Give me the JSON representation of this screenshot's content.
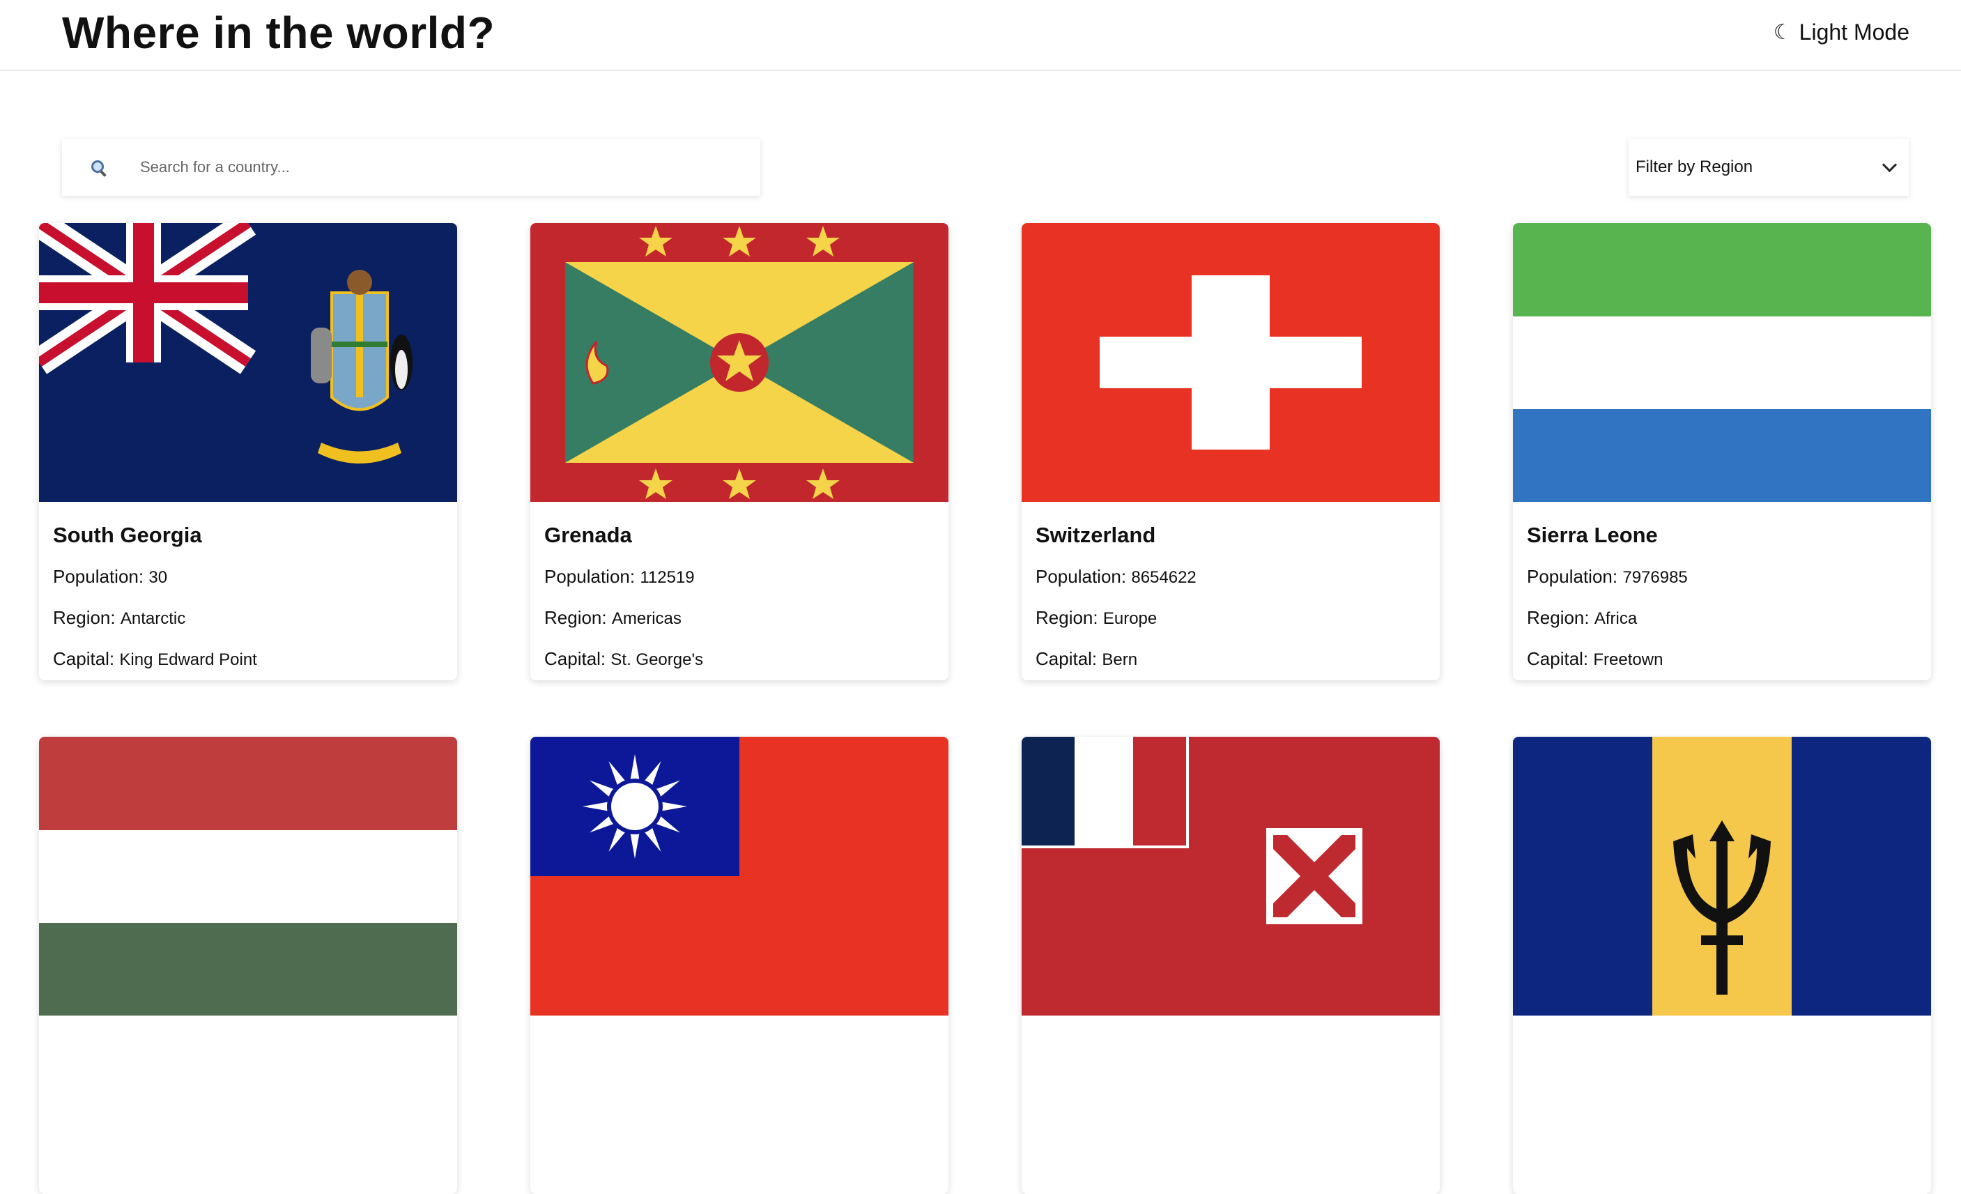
{
  "header": {
    "title": "Where in the world?",
    "theme_icon": "☾",
    "theme_label": "Light Mode"
  },
  "search": {
    "placeholder": "Search for a country...",
    "value": ""
  },
  "filter": {
    "label": "Filter by Region"
  },
  "field_labels": {
    "population": "Population:",
    "region": "Region:",
    "capital": "Capital:"
  },
  "countries": [
    {
      "name": "South Georgia",
      "population": "30",
      "region": "Antarctic",
      "capital": "King Edward Point",
      "flag": "south-georgia"
    },
    {
      "name": "Grenada",
      "population": "112519",
      "region": "Americas",
      "capital": "St. George's",
      "flag": "grenada"
    },
    {
      "name": "Switzerland",
      "population": "8654622",
      "region": "Europe",
      "capital": "Bern",
      "flag": "switzerland"
    },
    {
      "name": "Sierra Leone",
      "population": "7976985",
      "region": "Africa",
      "capital": "Freetown",
      "flag": "sierra-leone"
    },
    {
      "name": "",
      "population": "",
      "region": "",
      "capital": "",
      "flag": "hungary"
    },
    {
      "name": "",
      "population": "",
      "region": "",
      "capital": "",
      "flag": "taiwan"
    },
    {
      "name": "",
      "population": "",
      "region": "",
      "capital": "",
      "flag": "wallis-and-futuna"
    },
    {
      "name": "",
      "population": "",
      "region": "",
      "capital": "",
      "flag": "barbados"
    }
  ]
}
